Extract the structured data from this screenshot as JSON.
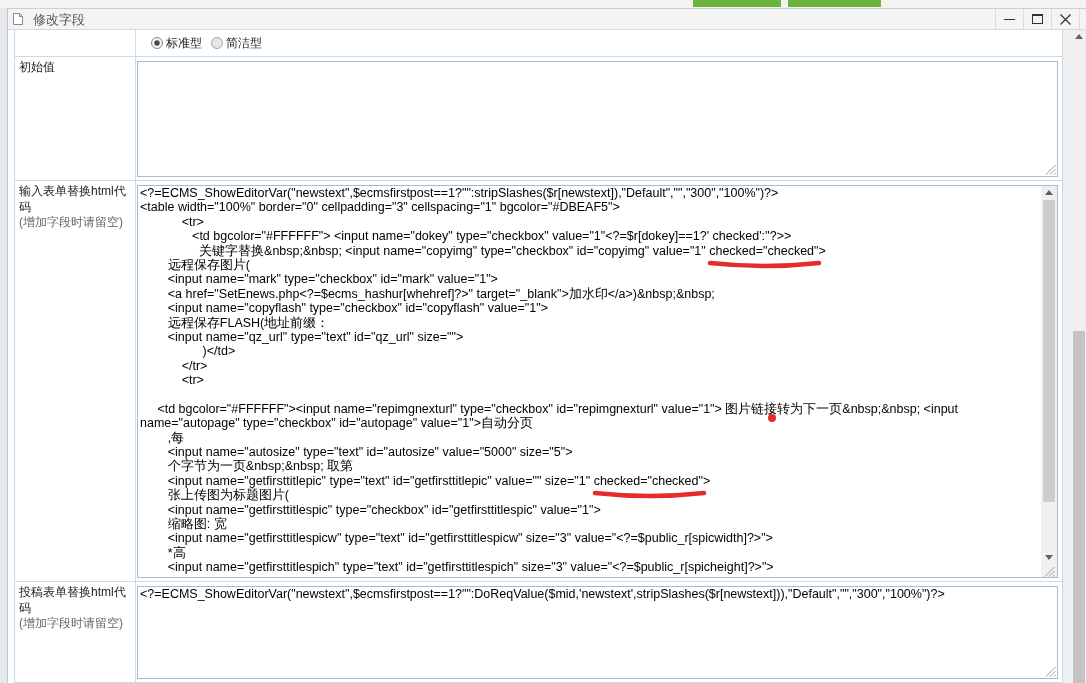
{
  "window": {
    "title": "修改字段"
  },
  "form": {
    "rows": [
      {
        "kind": "radios",
        "options": [
          {
            "label": "标准型",
            "selected": true
          },
          {
            "label": "简洁型",
            "selected": false
          }
        ]
      },
      {
        "kind": "editor",
        "label": "初始值",
        "scrollable": false
      },
      {
        "kind": "editor",
        "label": "输入表单替换html代码",
        "hint": "(增加字段时请留空)",
        "scrollable": true,
        "lines": [
          {
            "kind": "text",
            "text": "<?=ECMS_ShowEditorVar(\"newstext\",$ecmsfirstpost==1?\"\":stripSlashes($r[newstext]),\"Default\",\"\",\"300\",\"100%\")?>"
          },
          {
            "kind": "text",
            "text": "<table width=\"100%\" border=\"0\" cellpadding=\"3\" cellspacing=\"1\" bgcolor=\"#DBEAF5\">"
          },
          {
            "kind": "text",
            "text": "            <tr>"
          },
          {
            "kind": "text",
            "text": "               <td bgcolor=\"#FFFFFF\"> <input name=\"dokey\" type=\"checkbox\" value=\"1\"<?=$r[dokey]==1?' checked':''?>>"
          },
          {
            "kind": "marked",
            "parts": [
              {
                "kind": "plain",
                "text": "                 关键字替换&nbsp;&nbsp; <input name=\"copyimg\" type=\"checkbox\" id=\"copyimg\" value=\"1\" "
              },
              {
                "kind": "underlined",
                "text": "checked=\"checked\""
              },
              {
                "kind": "plain",
                "text": ">"
              }
            ]
          },
          {
            "kind": "text",
            "text": "        远程保存图片("
          },
          {
            "kind": "text",
            "text": "        <input name=\"mark\" type=\"checkbox\" id=\"mark\" value=\"1\">"
          },
          {
            "kind": "text",
            "text": "        <a href=\"SetEnews.php<?=$ecms_hashur[whehref]?>\" target=\"_blank\">加水印</a>)&nbsp;&nbsp;"
          },
          {
            "kind": "text",
            "text": "        <input name=\"copyflash\" type=\"checkbox\" id=\"copyflash\" value=\"1\">"
          },
          {
            "kind": "text",
            "text": "        远程保存FLASH(地址前缀："
          },
          {
            "kind": "text",
            "text": "        <input name=\"qz_url\" type=\"text\" id=\"qz_url\" size=\"\">"
          },
          {
            "kind": "text",
            "text": "                  )</td>"
          },
          {
            "kind": "text",
            "text": "            </tr>"
          },
          {
            "kind": "text",
            "text": "            <tr>"
          },
          {
            "kind": "blank"
          },
          {
            "kind": "marked",
            "parts": [
              {
                "kind": "plain",
                "text": "     <td bgcolor=\"#FFFFFF\"><input name=\"repimgnexturl\" type=\"checkbox\" id=\"repimgnexturl\" value=\"1\"> 图片链"
              },
              {
                "kind": "dotted",
                "text": "接"
              },
              {
                "kind": "plain",
                "text": "转为下一页&nbsp;&nbsp; <input"
              }
            ]
          },
          {
            "kind": "text",
            "text": "name=\"autopage\" type=\"checkbox\" id=\"autopage\" value=\"1\">自动分页"
          },
          {
            "kind": "text",
            "text": "        ,每"
          },
          {
            "kind": "text",
            "text": "        <input name=\"autosize\" type=\"text\" id=\"autosize\" value=\"5000\" size=\"5\">"
          },
          {
            "kind": "text",
            "text": "        个字节为一页&nbsp;&nbsp; 取第"
          },
          {
            "kind": "marked",
            "parts": [
              {
                "kind": "plain",
                "text": "        <input name=\"getfirsttitlepic\" type=\"text\" id=\"getfirsttitlepic\" value=\"\" size=\"1\" "
              },
              {
                "kind": "underlined",
                "text": "checked=\"checked\""
              },
              {
                "kind": "plain",
                "text": ">"
              }
            ]
          },
          {
            "kind": "text",
            "text": "        张上传图为标题图片("
          },
          {
            "kind": "text",
            "text": "        <input name=\"getfirsttitlespic\" type=\"checkbox\" id=\"getfirsttitlespic\" value=\"1\">"
          },
          {
            "kind": "text",
            "text": "        缩略图: 宽"
          },
          {
            "kind": "text",
            "text": "        <input name=\"getfirsttitlespicw\" type=\"text\" id=\"getfirsttitlespicw\" size=\"3\" value=\"<?=$public_r[spicwidth]?>\">"
          },
          {
            "kind": "text",
            "text": "        *高"
          },
          {
            "kind": "text",
            "text": "        <input name=\"getfirsttitlespich\" type=\"text\" id=\"getfirsttitlespich\" size=\"3\" value=\"<?=$public_r[spicheight]?>\">"
          }
        ]
      },
      {
        "kind": "editor",
        "label": "投稿表单替换html代码",
        "hint": "(增加字段时请留空)",
        "scrollable": false,
        "lines": [
          {
            "kind": "text",
            "text": "<?=ECMS_ShowEditorVar(\"newstext\",$ecmsfirstpost==1?\"\":DoReqValue($mid,'newstext',stripSlashes($r[newstext])),\"Default\",\"\",\"300\",\"100%\")?>"
          }
        ]
      }
    ]
  }
}
